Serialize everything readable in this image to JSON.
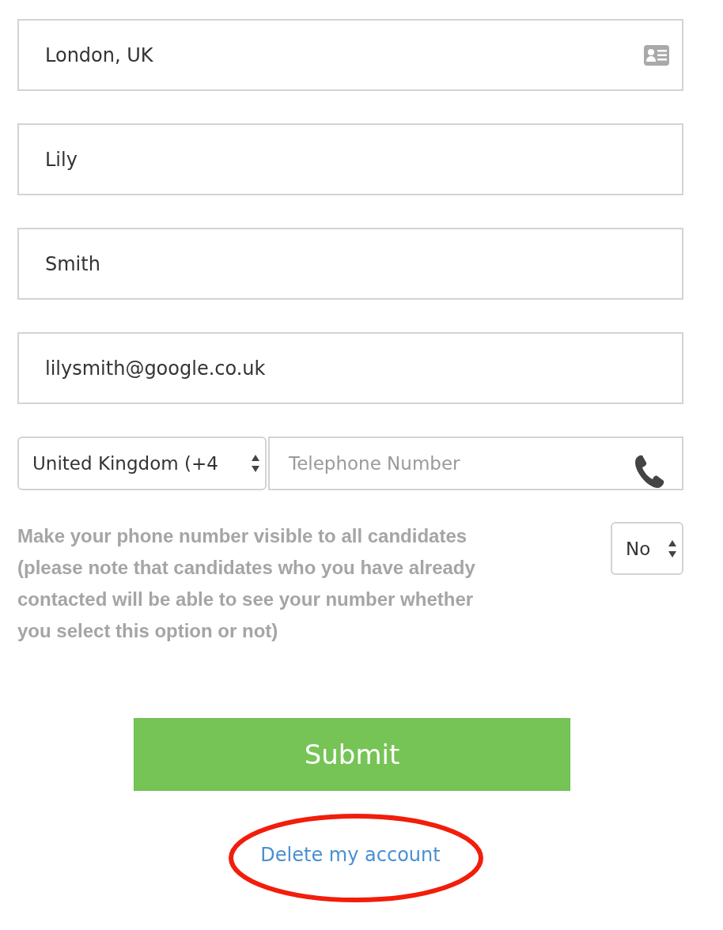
{
  "fields": [
    {
      "value": "London, UK",
      "kind": "location"
    },
    {
      "value": "Lily",
      "kind": "text"
    },
    {
      "value": "Smith",
      "kind": "text"
    },
    {
      "value": "lilysmith@google.co.uk",
      "kind": "text"
    }
  ],
  "phone": {
    "country": "United Kingdom (+4",
    "placeholder": "Telephone Number"
  },
  "visibility": {
    "label": "Make your phone number visible to all candidates (please note that candidates who you have already contacted will be able to see your number whether you select this option or not)",
    "value": "No"
  },
  "submit": "Submit",
  "delete_link": "Delete my account"
}
